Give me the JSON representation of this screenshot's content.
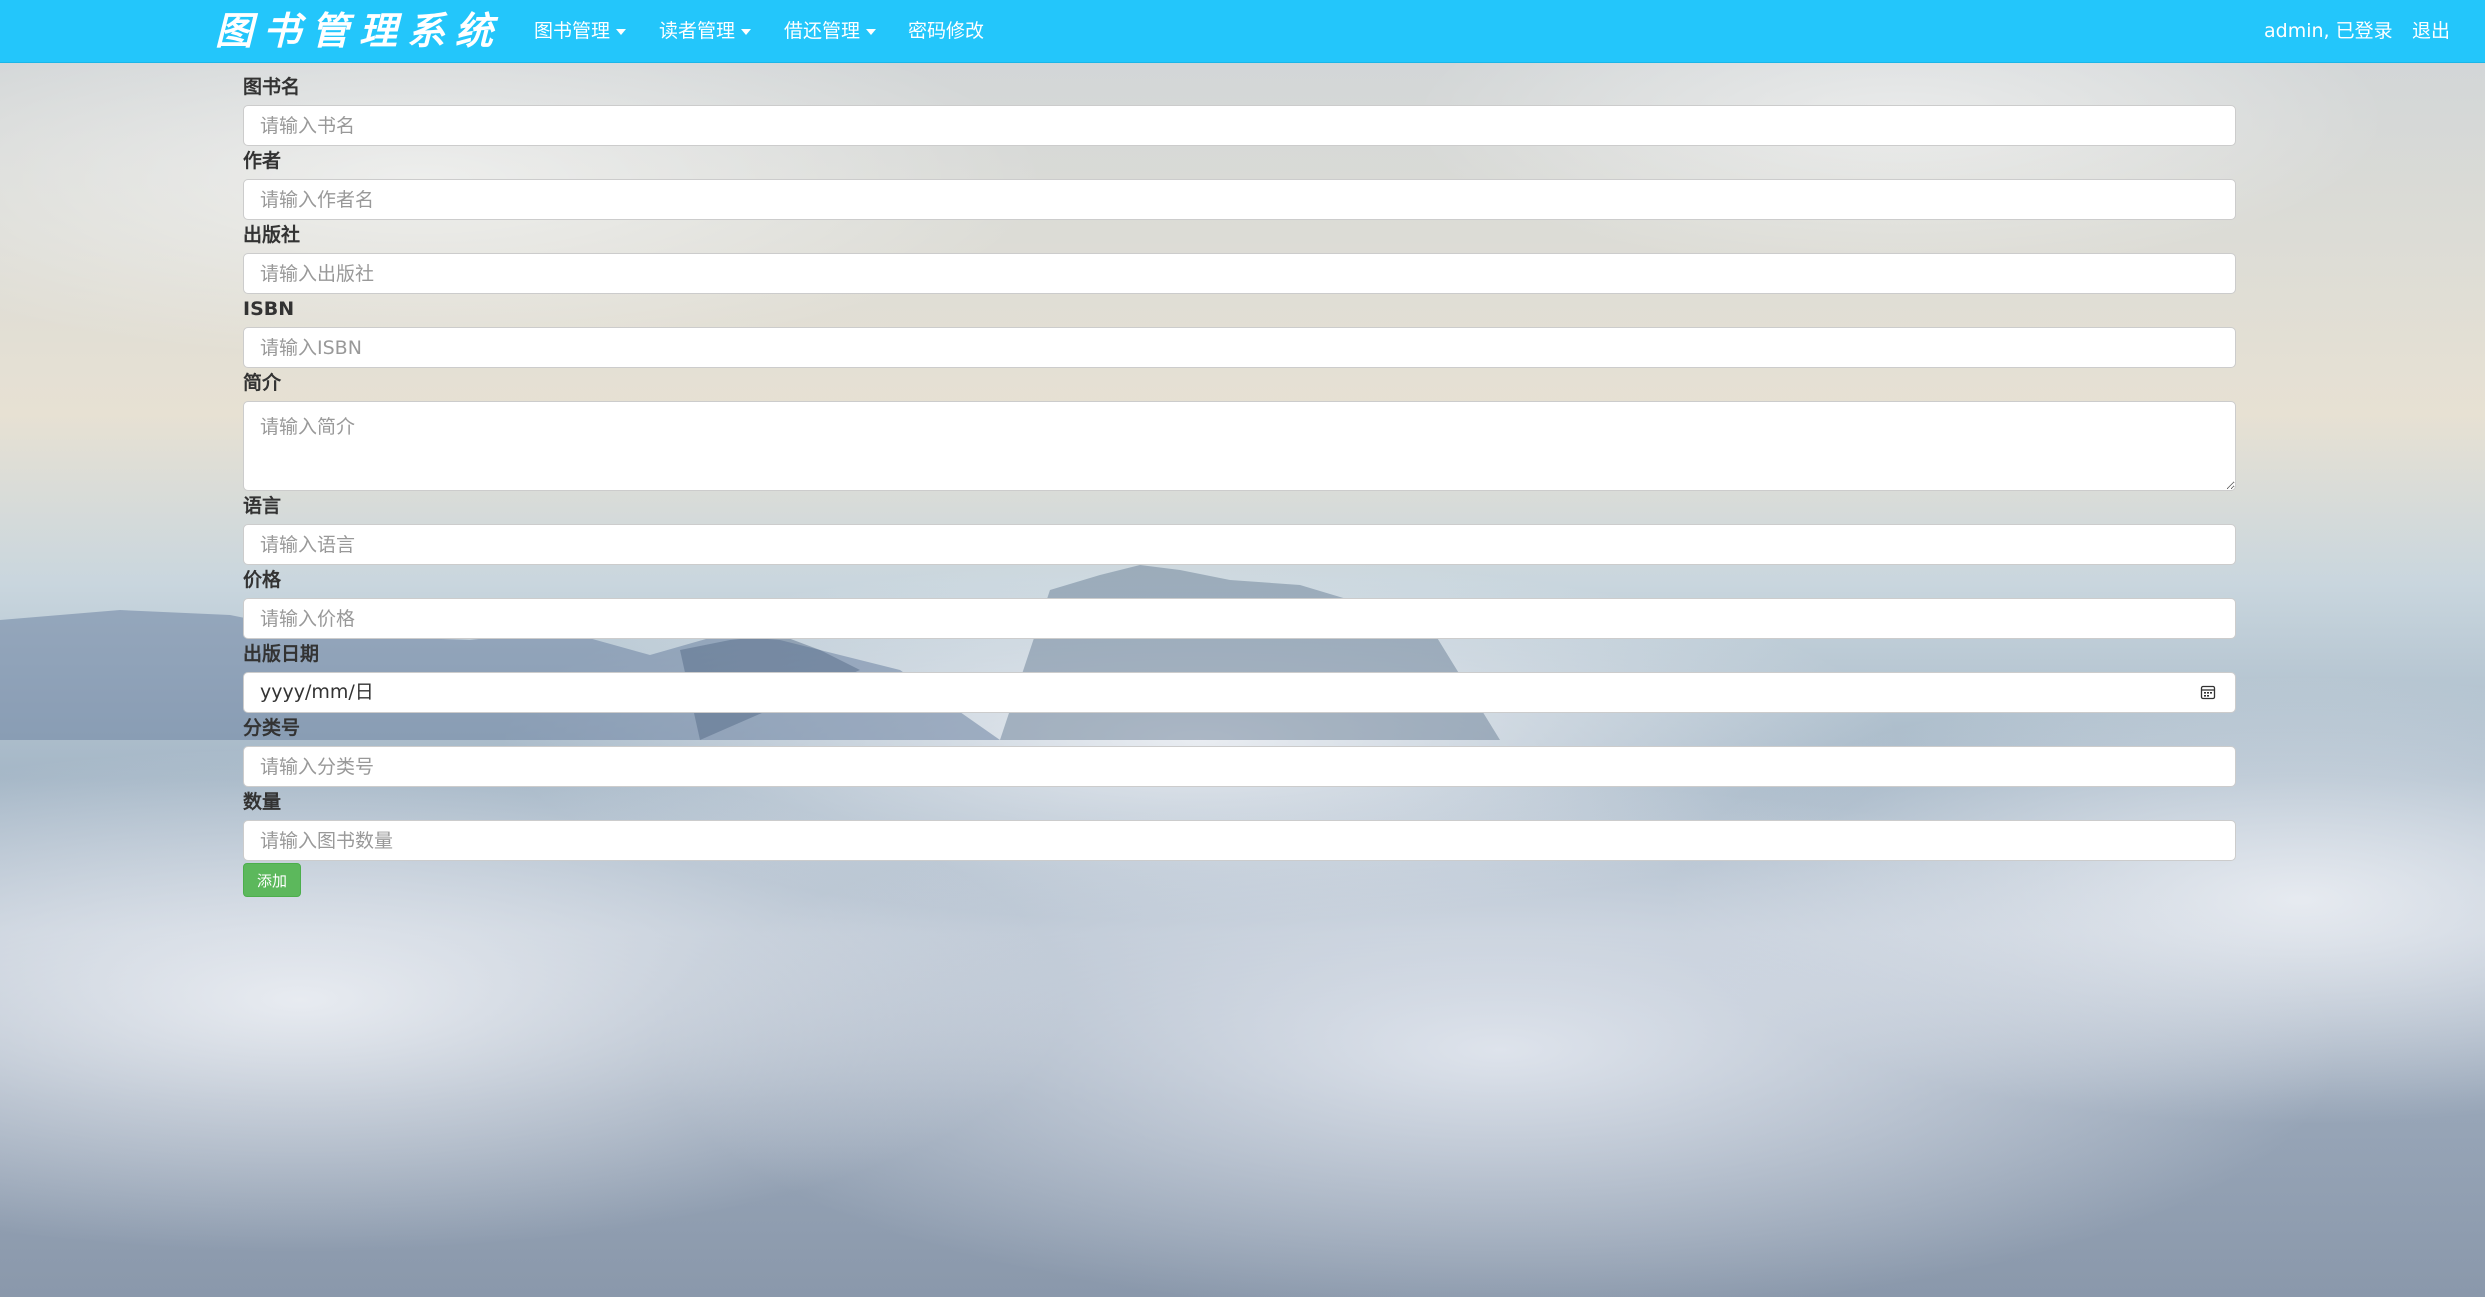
{
  "navbar": {
    "brand": "图书管理系统",
    "menu": [
      {
        "label": "图书管理",
        "dropdown": true
      },
      {
        "label": "读者管理",
        "dropdown": true
      },
      {
        "label": "借还管理",
        "dropdown": true
      },
      {
        "label": "密码修改",
        "dropdown": false
      }
    ],
    "user_status": "admin, 已登录",
    "logout": "退出",
    "color": "#23c6fb"
  },
  "form": {
    "fields": [
      {
        "label": "图书名",
        "placeholder": "请输入书名"
      },
      {
        "label": "作者",
        "placeholder": "请输入作者名"
      },
      {
        "label": "出版社",
        "placeholder": "请输入出版社"
      },
      {
        "label": "ISBN",
        "placeholder": "请输入ISBN"
      },
      {
        "label": "简介",
        "placeholder": "请输入简介"
      },
      {
        "label": "语言",
        "placeholder": "请输入语言"
      },
      {
        "label": "价格",
        "placeholder": "请输入价格"
      },
      {
        "label": "出版日期",
        "date_placeholder": "yyyy/mm/日"
      },
      {
        "label": "分类号",
        "placeholder": "请输入分类号"
      },
      {
        "label": "数量",
        "placeholder": "请输入图书数量"
      }
    ],
    "submit_label": "添加",
    "submit_color": "#5cb85c"
  },
  "icons": {
    "calendar": "calendar-icon",
    "caret": "caret-down-icon"
  }
}
